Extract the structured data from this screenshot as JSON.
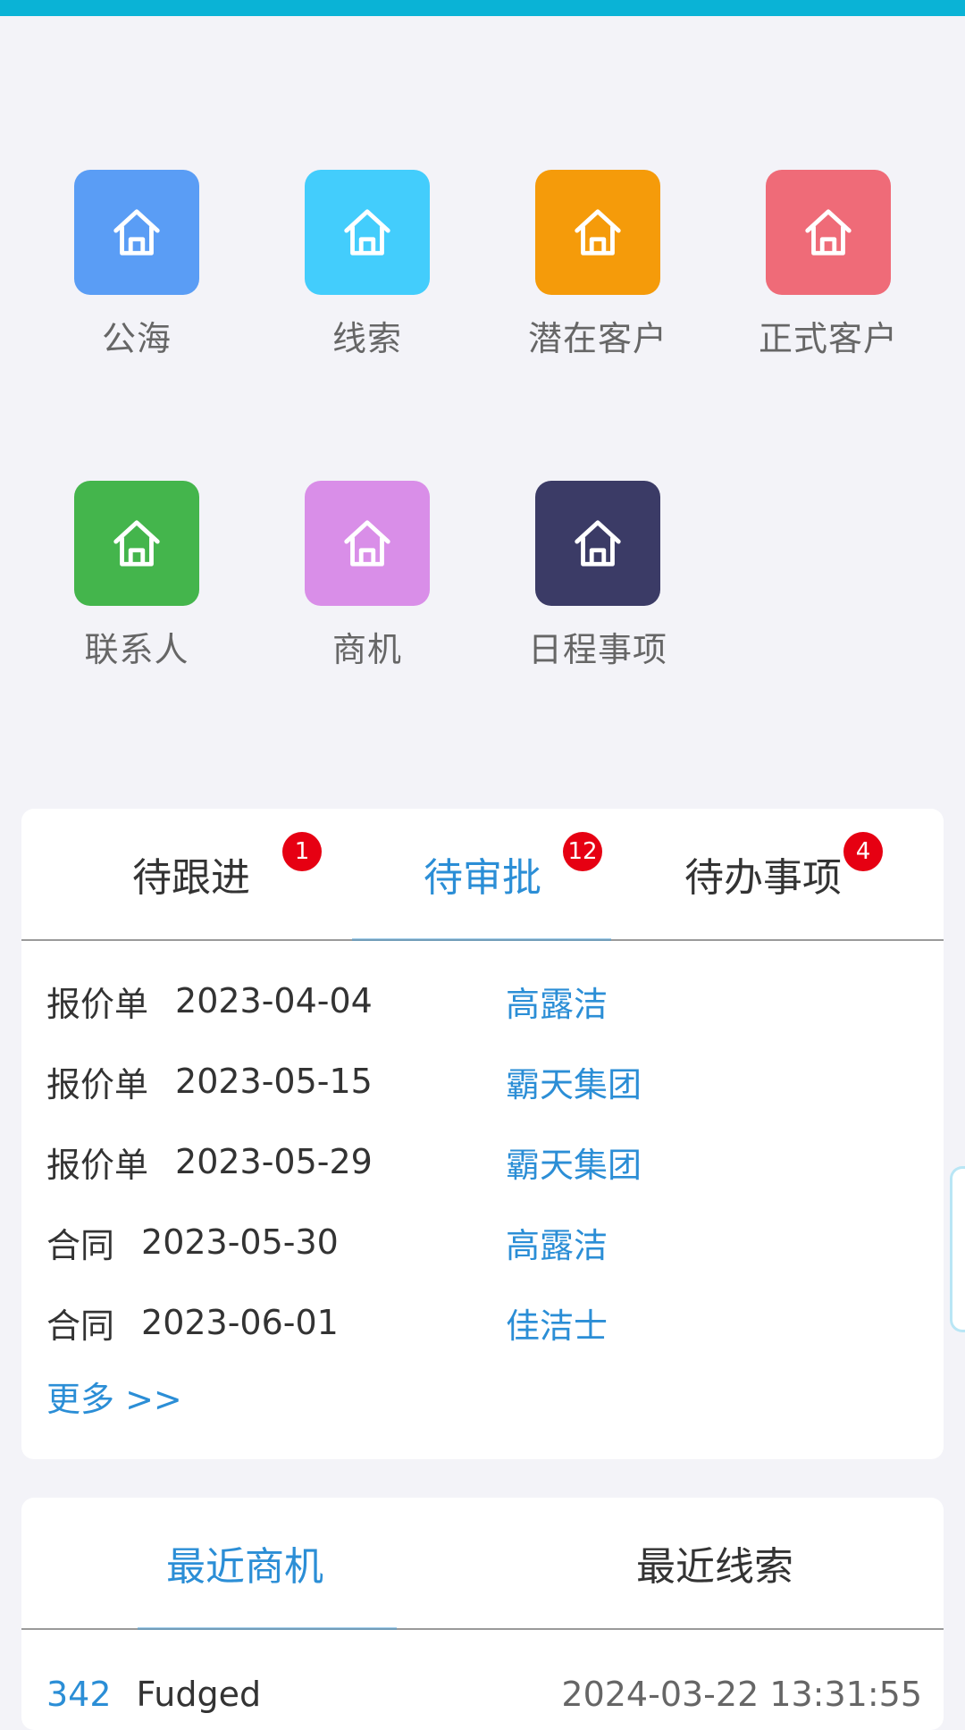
{
  "icons": [
    {
      "label": "公海",
      "color": "#5a9df5",
      "icon": "home-icon"
    },
    {
      "label": "线索",
      "color": "#43cdfc",
      "icon": "home-icon"
    },
    {
      "label": "潜在客户",
      "color": "#f59b0a",
      "icon": "home-icon"
    },
    {
      "label": "正式客户",
      "color": "#ef6b78",
      "icon": "home-icon"
    },
    {
      "label": "联系人",
      "color": "#44b54c",
      "icon": "home-icon"
    },
    {
      "label": "商机",
      "color": "#d98ee8",
      "icon": "home-icon"
    },
    {
      "label": "日程事项",
      "color": "#3b3b66",
      "icon": "home-icon"
    }
  ],
  "tasks": {
    "tabs": [
      {
        "label": "待跟进",
        "badge": "1"
      },
      {
        "label": "待审批",
        "badge": "12"
      },
      {
        "label": "待办事项",
        "badge": "4"
      }
    ],
    "active_tab": 1,
    "rows": [
      {
        "type": "报价单",
        "date": "2023-04-04",
        "name": "高露洁"
      },
      {
        "type": "报价单",
        "date": "2023-05-15",
        "name": "霸天集团"
      },
      {
        "type": "报价单",
        "date": "2023-05-29",
        "name": "霸天集团"
      },
      {
        "type": "合同",
        "date": "2023-05-30",
        "name": "高露洁"
      },
      {
        "type": "合同",
        "date": "2023-06-01",
        "name": "佳洁士"
      }
    ],
    "more_label": "更多 >>"
  },
  "recent": {
    "tabs": [
      {
        "label": "最近商机"
      },
      {
        "label": "最近线索"
      }
    ],
    "active_tab": 0,
    "rows": [
      {
        "id": "342",
        "name": "Fudged",
        "time": "2024-03-22 13:31:55"
      }
    ]
  },
  "colors": {
    "accent": "#2b8ed6",
    "badge": "#e60012",
    "topbar": "#0ab3d6"
  }
}
